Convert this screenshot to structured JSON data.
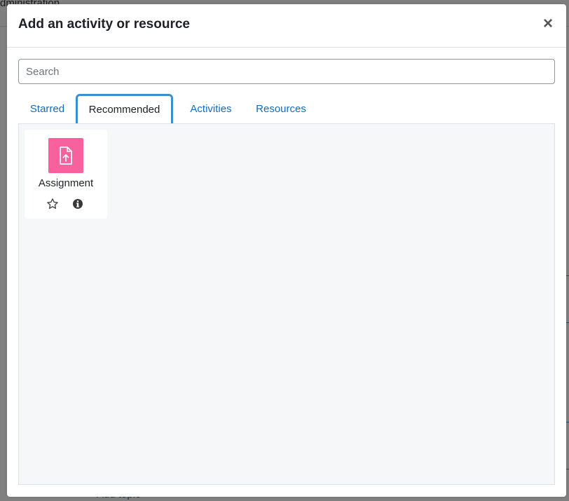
{
  "background": {
    "admin_text": "dministration",
    "right_char": "c",
    "add_topic": "Add topic"
  },
  "modal": {
    "title": "Add an activity or resource",
    "close_symbol": "×",
    "search": {
      "placeholder": "Search",
      "value": ""
    },
    "tabs": [
      {
        "label": "Starred",
        "active": false
      },
      {
        "label": "Recommended",
        "active": true
      },
      {
        "label": "Activities",
        "active": false
      },
      {
        "label": "Resources",
        "active": false
      }
    ],
    "items": [
      {
        "label": "Assignment",
        "icon": "assignment-upload-icon",
        "icon_color": "#f7629e",
        "star_icon": "star-outline-icon",
        "info_icon": "info-circle-icon"
      }
    ]
  },
  "colors": {
    "link": "#0f6cbf",
    "active_tab_border": "#3a8fcf",
    "content_bg": "#f5f7f9"
  }
}
